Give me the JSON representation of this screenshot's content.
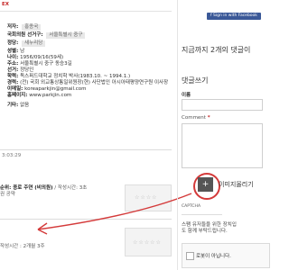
{
  "top_marks": "EX",
  "profile": {
    "name_label": "저자:",
    "name_value": "홍종국",
    "member_label": "국회의원 선거구:",
    "member_value": "서울특별시 중구",
    "party_label": "정당:",
    "party_value": "새누리당",
    "gender_label": "성별:",
    "gender_value": "남",
    "birth_label": "나이:",
    "birth_value": "1956/09/16(59세)",
    "address_label": "주소:",
    "address_value": "서울특별시 중구 동승3길",
    "religion_label": "선거:",
    "religion_value": "정당인",
    "edu_label": "학력:",
    "edu_value": "독스퍼드대학교 정치학 박사(1983.10. ~ 1994.1.)",
    "career_label": "경력:",
    "career_value": "(전) 국회 외교통상통일위원장(현) 사단법인 아시아태평양연구원 이사장",
    "email_label": "이메일:",
    "email_value": "koreaparkjin@gmail.com",
    "homepage_label": "홈페이지:",
    "homepage_value": "www.parkjin.com",
    "other_label": "기타:",
    "other_value": "없음"
  },
  "timestamp": "3:03:29",
  "post": {
    "title": "순위: 종로 주연 (비의원)",
    "meta": " / 작성시간: 3초",
    "sub": "권 공약"
  },
  "footer": {
    "meta": "작성시간 : 2개월 3주"
  },
  "right": {
    "fb_button": "Sign in with Facebook",
    "comments_title": "지금까지 2개의 댓글이",
    "write_title": "댓글쓰기",
    "name_label": "이름",
    "comment_label": "Comment",
    "add_btn": "+",
    "image_upload": "이미지올리기",
    "captcha_label": "CAPTCHA",
    "spam_line1": "스팸 유저들을 위한 장치입",
    "spam_line2": "도 함께 부탁드립니다.",
    "robot_text": "로봇이 아닙니다."
  }
}
